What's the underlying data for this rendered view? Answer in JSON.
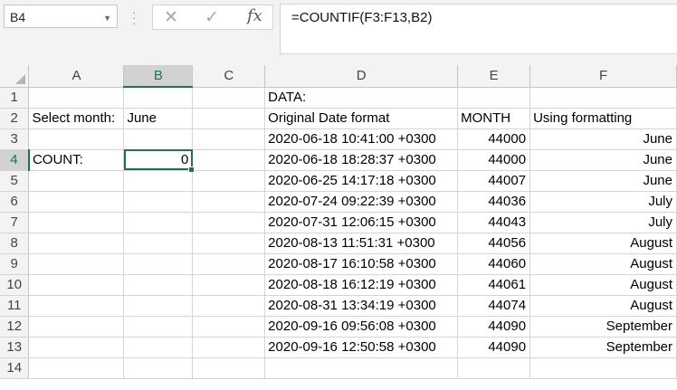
{
  "name_box": {
    "value": "B4"
  },
  "formula_bar": {
    "cancel_icon": "✕",
    "enter_icon": "✓",
    "fx_icon": "fx",
    "formula": "=COUNTIF(F3:F13,B2)"
  },
  "columns": [
    "A",
    "B",
    "C",
    "D",
    "E",
    "F"
  ],
  "selected_column": "B",
  "selected_row": "4",
  "rows": [
    {
      "num": "1",
      "A": "",
      "B": "",
      "C": "",
      "D": "DATA:",
      "E": "",
      "F": ""
    },
    {
      "num": "2",
      "A": "Select month:",
      "B": "June",
      "C": "",
      "D": "Original Date format",
      "E": "MONTH",
      "F": "Using formatting"
    },
    {
      "num": "3",
      "A": "",
      "B": "",
      "C": "",
      "D": "2020-06-18 10:41:00 +0300",
      "E": "44000",
      "F": "June"
    },
    {
      "num": "4",
      "A": "COUNT:",
      "B": "0",
      "C": "",
      "D": "2020-06-18 18:28:37 +0300",
      "E": "44000",
      "F": "June"
    },
    {
      "num": "5",
      "A": "",
      "B": "",
      "C": "",
      "D": "2020-06-25 14:17:18 +0300",
      "E": "44007",
      "F": "June"
    },
    {
      "num": "6",
      "A": "",
      "B": "",
      "C": "",
      "D": "2020-07-24 09:22:39 +0300",
      "E": "44036",
      "F": "July"
    },
    {
      "num": "7",
      "A": "",
      "B": "",
      "C": "",
      "D": "2020-07-31 12:06:15 +0300",
      "E": "44043",
      "F": "July"
    },
    {
      "num": "8",
      "A": "",
      "B": "",
      "C": "",
      "D": "2020-08-13 11:51:31 +0300",
      "E": "44056",
      "F": "August"
    },
    {
      "num": "9",
      "A": "",
      "B": "",
      "C": "",
      "D": "2020-08-17 16:10:58 +0300",
      "E": "44060",
      "F": "August"
    },
    {
      "num": "10",
      "A": "",
      "B": "",
      "C": "",
      "D": "2020-08-18 16:12:19 +0300",
      "E": "44061",
      "F": "August"
    },
    {
      "num": "11",
      "A": "",
      "B": "",
      "C": "",
      "D": "2020-08-31 13:34:19 +0300",
      "E": "44074",
      "F": "August"
    },
    {
      "num": "12",
      "A": "",
      "B": "",
      "C": "",
      "D": "2020-09-16 09:56:08 +0300",
      "E": "44090",
      "F": "September"
    },
    {
      "num": "13",
      "A": "",
      "B": "",
      "C": "",
      "D": "2020-09-16 12:50:58 +0300",
      "E": "44090",
      "F": "September"
    },
    {
      "num": "14",
      "A": "",
      "B": "",
      "C": "",
      "D": "",
      "E": "",
      "F": ""
    }
  ]
}
